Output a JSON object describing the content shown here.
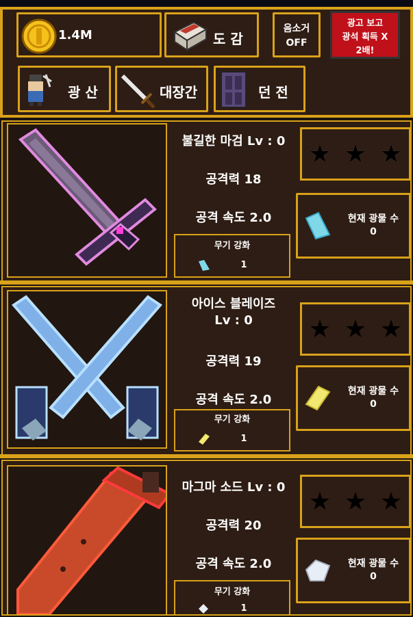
{
  "hud": {
    "gold": "1.4M",
    "codex": "도 감",
    "sound": {
      "line1": "음소거",
      "line2": "OFF"
    },
    "ad": {
      "line1": "광고 보고",
      "line2": "광석 획득 X",
      "line3": "2배!"
    },
    "nav": {
      "mine": "광 산",
      "smithy": "대장간",
      "dungeon": "던 전"
    }
  },
  "weapons": [
    {
      "name": "불길한 마검 Lv : 0",
      "name2": "",
      "attack": "공격력 18",
      "speed": "공격 속도 2.0",
      "upgrade_title": "무기 강화",
      "upgrade_cost": "1",
      "ore_label": "현재 광물 수",
      "ore_count": "0",
      "ore_color": "#7fd8e8"
    },
    {
      "name": "아이스 블레이즈",
      "name2": "Lv : 0",
      "attack": "공격력 19",
      "speed": "공격 속도 2.0",
      "upgrade_title": "무기 강화",
      "upgrade_cost": "1",
      "ore_label": "현재 광물 수",
      "ore_count": "0",
      "ore_color": "#f0e870"
    },
    {
      "name": "마그마 소드 Lv : 0",
      "name2": "",
      "attack": "공격력 20",
      "speed": "공격 속도 2.0",
      "upgrade_title": "무기 강화",
      "upgrade_cost": "1",
      "ore_label": "현재 광물 수",
      "ore_count": "0",
      "ore_color": "#e8eef5"
    }
  ]
}
